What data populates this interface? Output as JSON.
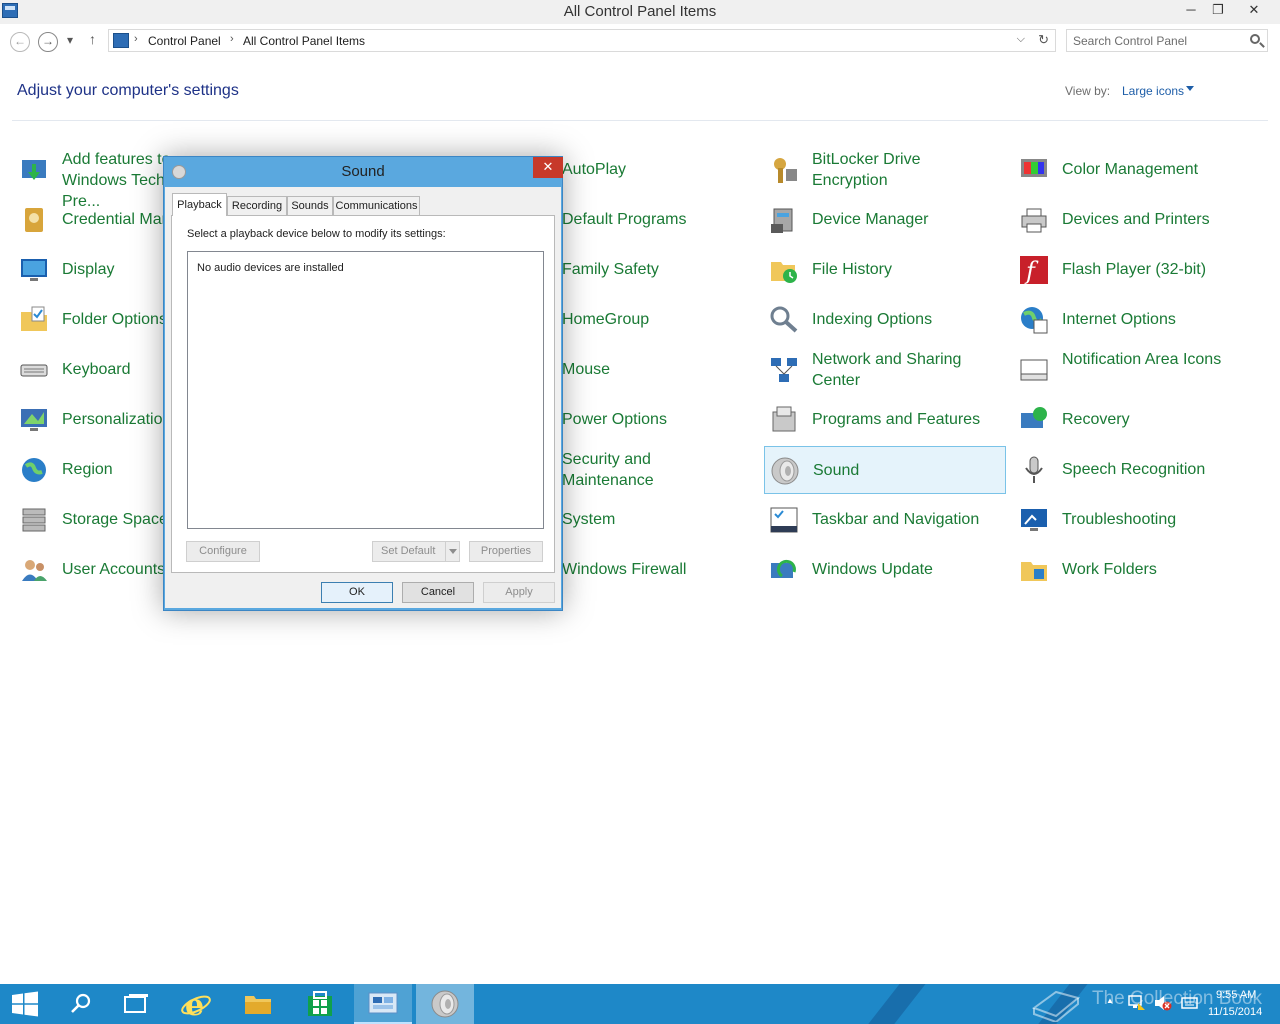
{
  "window": {
    "title": "All Control Panel Items",
    "minimize": "─",
    "restore": "❐",
    "close": "✕"
  },
  "navigation": {
    "back": "←",
    "forward": "→",
    "recent": "▾",
    "up": "↑",
    "breadcrumbs": [
      "Control Panel",
      "All Control Panel Items"
    ],
    "separator": "›",
    "dropdown": "⌵",
    "refresh": "↻",
    "search_placeholder": "Search Control Panel"
  },
  "header": {
    "heading": "Adjust your computer's settings",
    "view_by_label": "View by:",
    "view_by_value": "Large icons"
  },
  "items": [
    {
      "label": "Add features to Windows Technical Pre...",
      "icon": "add-features-icon"
    },
    {
      "label": "Credential Manager",
      "icon": "credential-manager-icon"
    },
    {
      "label": "Display",
      "icon": "display-icon"
    },
    {
      "label": "Folder Options",
      "icon": "folder-options-icon"
    },
    {
      "label": "Keyboard",
      "icon": "keyboard-icon"
    },
    {
      "label": "Personalization",
      "icon": "personalization-icon"
    },
    {
      "label": "Region",
      "icon": "region-icon"
    },
    {
      "label": "Storage Spaces",
      "icon": "storage-spaces-icon"
    },
    {
      "label": "User Accounts",
      "icon": "user-accounts-icon"
    },
    {
      "label": "AutoPlay",
      "icon": "autoplay-icon"
    },
    {
      "label": "Default Programs",
      "icon": "default-programs-icon"
    },
    {
      "label": "Family Safety",
      "icon": "family-safety-icon"
    },
    {
      "label": "HomeGroup",
      "icon": "homegroup-icon"
    },
    {
      "label": "Mouse",
      "icon": "mouse-icon"
    },
    {
      "label": "Power Options",
      "icon": "power-options-icon"
    },
    {
      "label": "Security and Maintenance",
      "icon": "security-maintenance-icon"
    },
    {
      "label": "System",
      "icon": "system-icon"
    },
    {
      "label": "Windows Firewall",
      "icon": "windows-firewall-icon"
    },
    {
      "label": "BitLocker Drive Encryption",
      "icon": "bitlocker-icon"
    },
    {
      "label": "Device Manager",
      "icon": "device-manager-icon"
    },
    {
      "label": "File History",
      "icon": "file-history-icon"
    },
    {
      "label": "Indexing Options",
      "icon": "indexing-options-icon"
    },
    {
      "label": "Network and Sharing Center",
      "icon": "network-sharing-icon"
    },
    {
      "label": "Programs and Features",
      "icon": "programs-features-icon"
    },
    {
      "label": "Sound",
      "icon": "sound-icon"
    },
    {
      "label": "Taskbar and Navigation",
      "icon": "taskbar-navigation-icon"
    },
    {
      "label": "Windows Update",
      "icon": "windows-update-icon"
    },
    {
      "label": "Color Management",
      "icon": "color-management-icon"
    },
    {
      "label": "Devices and Printers",
      "icon": "devices-printers-icon"
    },
    {
      "label": "Flash Player (32-bit)",
      "icon": "flash-player-icon"
    },
    {
      "label": "Internet Options",
      "icon": "internet-options-icon"
    },
    {
      "label": "Notification Area Icons",
      "icon": "notification-area-icon"
    },
    {
      "label": "Recovery",
      "icon": "recovery-icon"
    },
    {
      "label": "Speech Recognition",
      "icon": "speech-recognition-icon"
    },
    {
      "label": "Troubleshooting",
      "icon": "troubleshooting-icon"
    },
    {
      "label": "Work Folders",
      "icon": "work-folders-icon"
    }
  ],
  "dialog": {
    "title": "Sound",
    "close": "✕",
    "tabs": [
      "Playback",
      "Recording",
      "Sounds",
      "Communications"
    ],
    "active_tab": "Playback",
    "instruction": "Select a playback device below to modify its settings:",
    "empty_message": "No audio devices are installed",
    "configure": "Configure",
    "set_default": "Set Default",
    "properties": "Properties",
    "ok": "OK",
    "cancel": "Cancel",
    "apply": "Apply"
  },
  "taskbar": {
    "time": "9:55 AM",
    "date": "11/15/2014",
    "watermark": "The Collection Book",
    "tray_up": "▲",
    "apps": [
      "start-icon",
      "search-icon",
      "task-view-icon",
      "internet-explorer-icon",
      "file-explorer-icon",
      "store-icon",
      "control-panel-icon",
      "sound-icon"
    ]
  },
  "colors": {
    "link_green": "#1a7a35",
    "heading_blue": "#1e3287",
    "taskbar_blue": "#1e88c8",
    "dialog_frame": "#5aa8df",
    "close_red": "#c7392a",
    "selection_bg": "#e5f3fb"
  }
}
